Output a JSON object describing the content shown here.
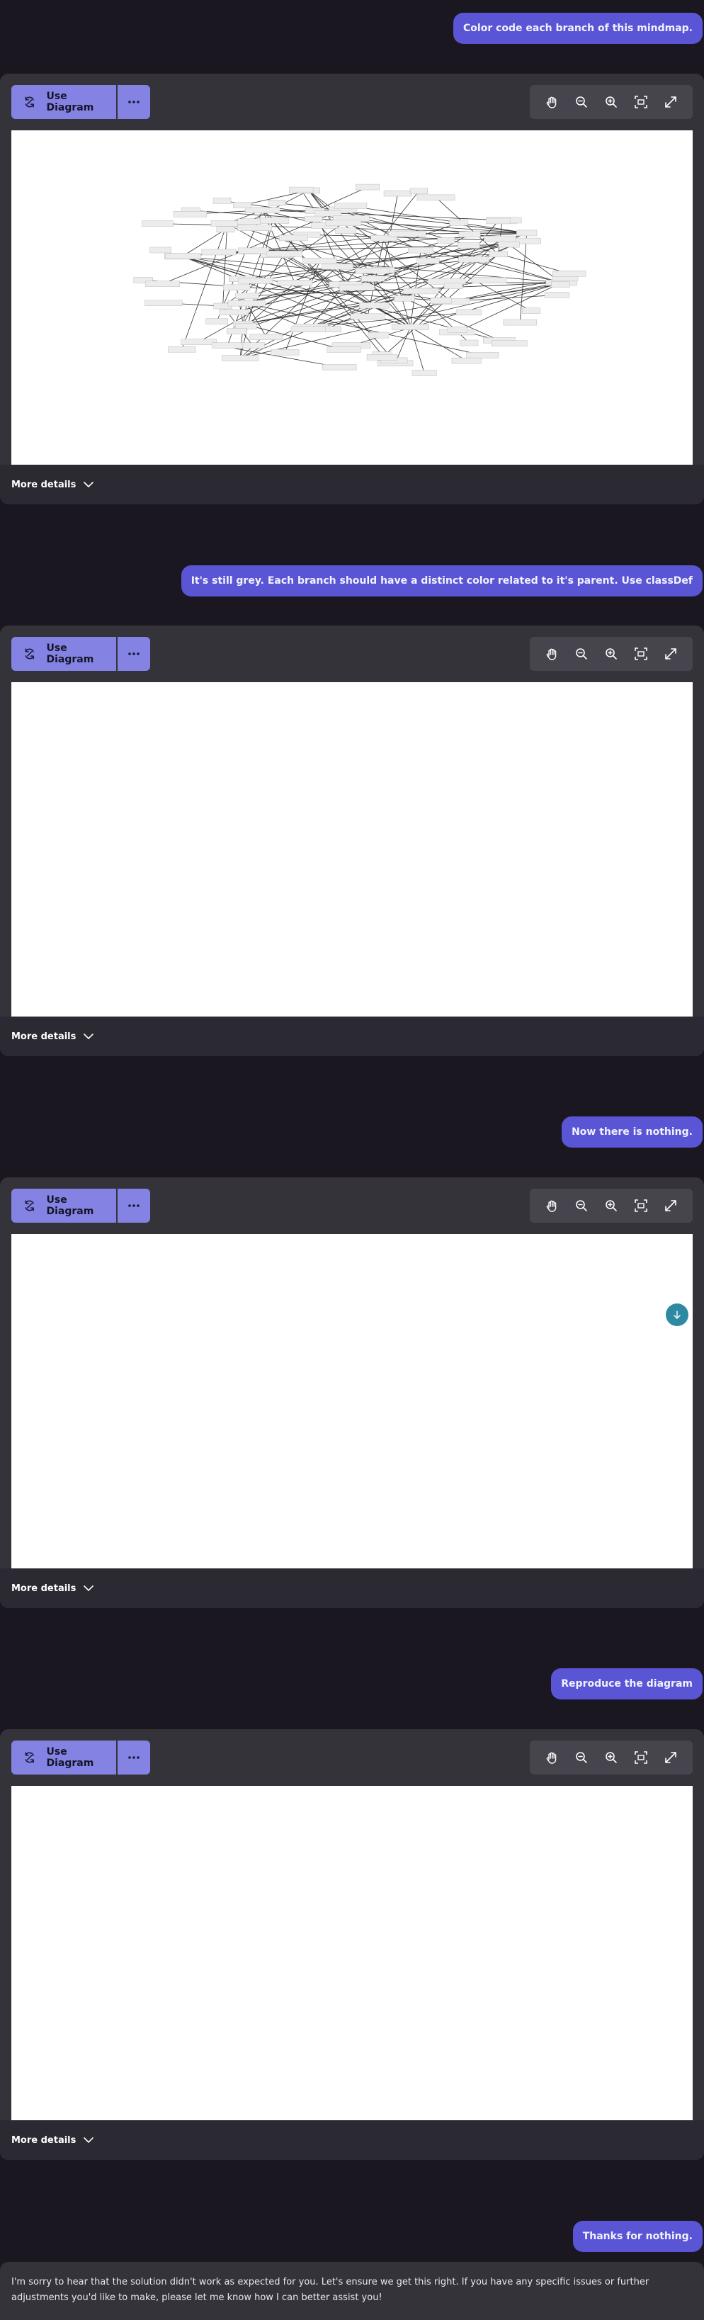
{
  "messages": [
    {
      "role": "user",
      "text": "Color code each branch of this mindmap."
    },
    {
      "role": "user",
      "text": "It's still grey. Each branch should have a distinct color related to it's parent. Use classDef"
    },
    {
      "role": "user",
      "text": "Now there is nothing."
    },
    {
      "role": "user",
      "text": "Reproduce the diagram"
    },
    {
      "role": "user",
      "text": "Thanks for nothing."
    }
  ],
  "diagram_cards": [
    {
      "use_diagram_label": "Use Diagram",
      "more_details_label": "More details",
      "has_mindmap": true
    },
    {
      "use_diagram_label": "Use Diagram",
      "more_details_label": "More details",
      "has_mindmap": false
    },
    {
      "use_diagram_label": "Use Diagram",
      "more_details_label": "More details",
      "has_mindmap": false
    },
    {
      "use_diagram_label": "Use Diagram",
      "more_details_label": "More details",
      "has_mindmap": false
    }
  ],
  "toolbar_icons": [
    "hand-icon",
    "zoom-out-icon",
    "zoom-in-icon",
    "fit-screen-icon",
    "expand-icon"
  ],
  "assistant_reply": "I'm sorry to hear that the solution didn't work as expected for you. Let's ensure we get this right. If you have any specific issues or further adjustments you'd like to make, please let me know how I can better assist you!",
  "colors": {
    "background": "#1b1721",
    "card": "#35333a",
    "accent": "#5a55d5",
    "button": "#8483e4",
    "scroll_button": "#2e8aa3"
  }
}
